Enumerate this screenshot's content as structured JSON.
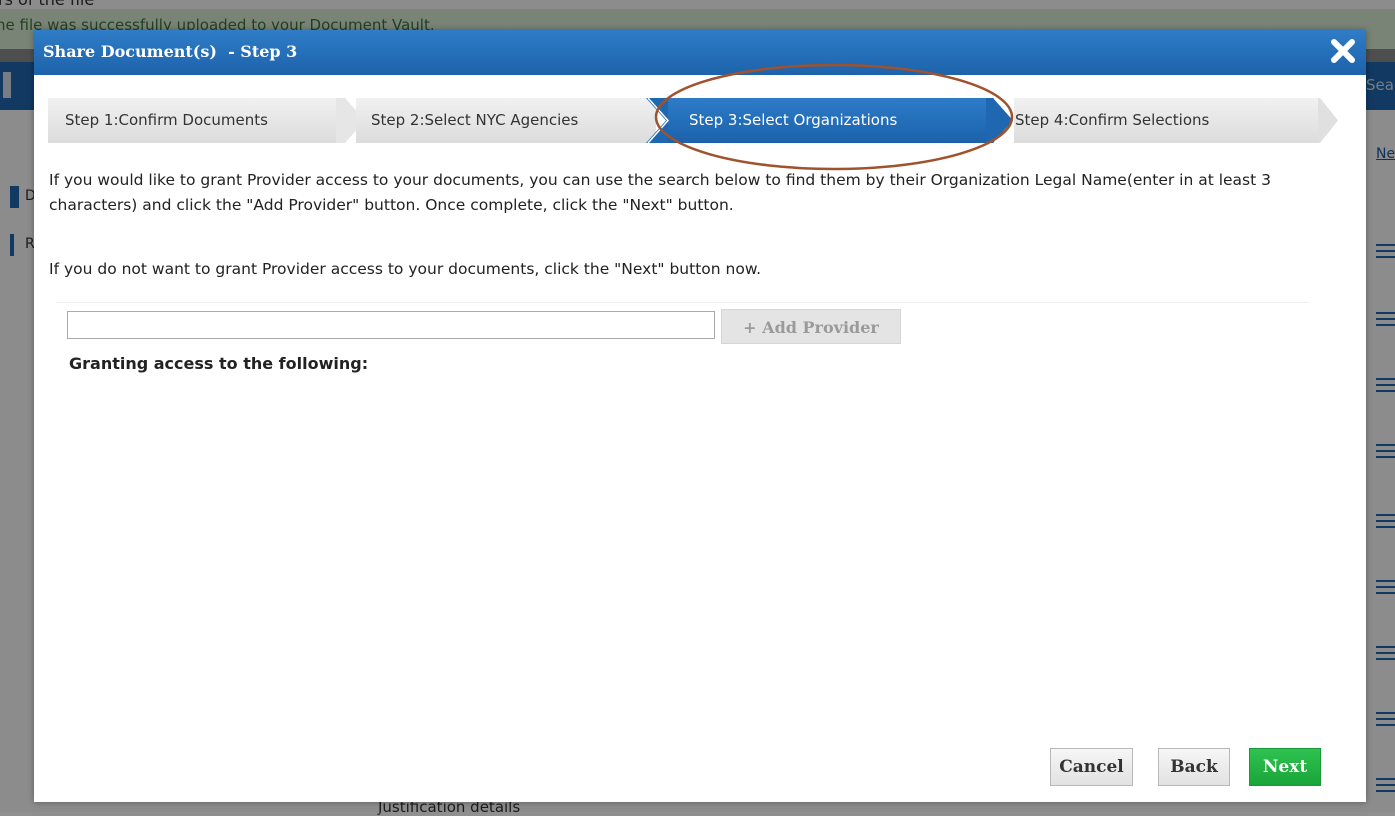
{
  "background": {
    "top_text": "rs of the file",
    "notice": "he file was successfully uploaded to your Document Vault.",
    "search_fragment": "Sea",
    "link_fragment": "Ne",
    "side_label_1": "D",
    "side_label_2": "R",
    "bottom_text": "Justification details"
  },
  "dialog": {
    "title": "Share Document(s)  - Step 3",
    "steps": [
      {
        "label": "Step 1:Confirm Documents",
        "active": false
      },
      {
        "label": "Step 2:Select NYC Agencies",
        "active": false
      },
      {
        "label": "Step 3:Select Organizations",
        "active": true
      },
      {
        "label": "Step 4:Confirm Selections",
        "active": false
      }
    ],
    "instructions": "If you would like to grant Provider access to your documents, you can use the search below to find them by their Organization Legal Name(enter in at least 3 characters) and click the \"Add Provider\" button. Once complete, click the \"Next\" button.",
    "skip_instructions": "If you do not want to grant Provider access to your documents, click the \"Next\" button now.",
    "search": {
      "value": "",
      "placeholder": ""
    },
    "add_provider_label": "+ Add Provider",
    "granting_label": "Granting access to the following:",
    "buttons": {
      "cancel": "Cancel",
      "back": "Back",
      "next": "Next"
    }
  },
  "colors": {
    "title_bar": "#1f68b1",
    "active_step": "#1f68b1",
    "next_button": "#22b044",
    "annotation_circle": "#a0522d"
  },
  "icons": {
    "close": "close-x-icon",
    "menu": "hamburger-menu-icon"
  }
}
